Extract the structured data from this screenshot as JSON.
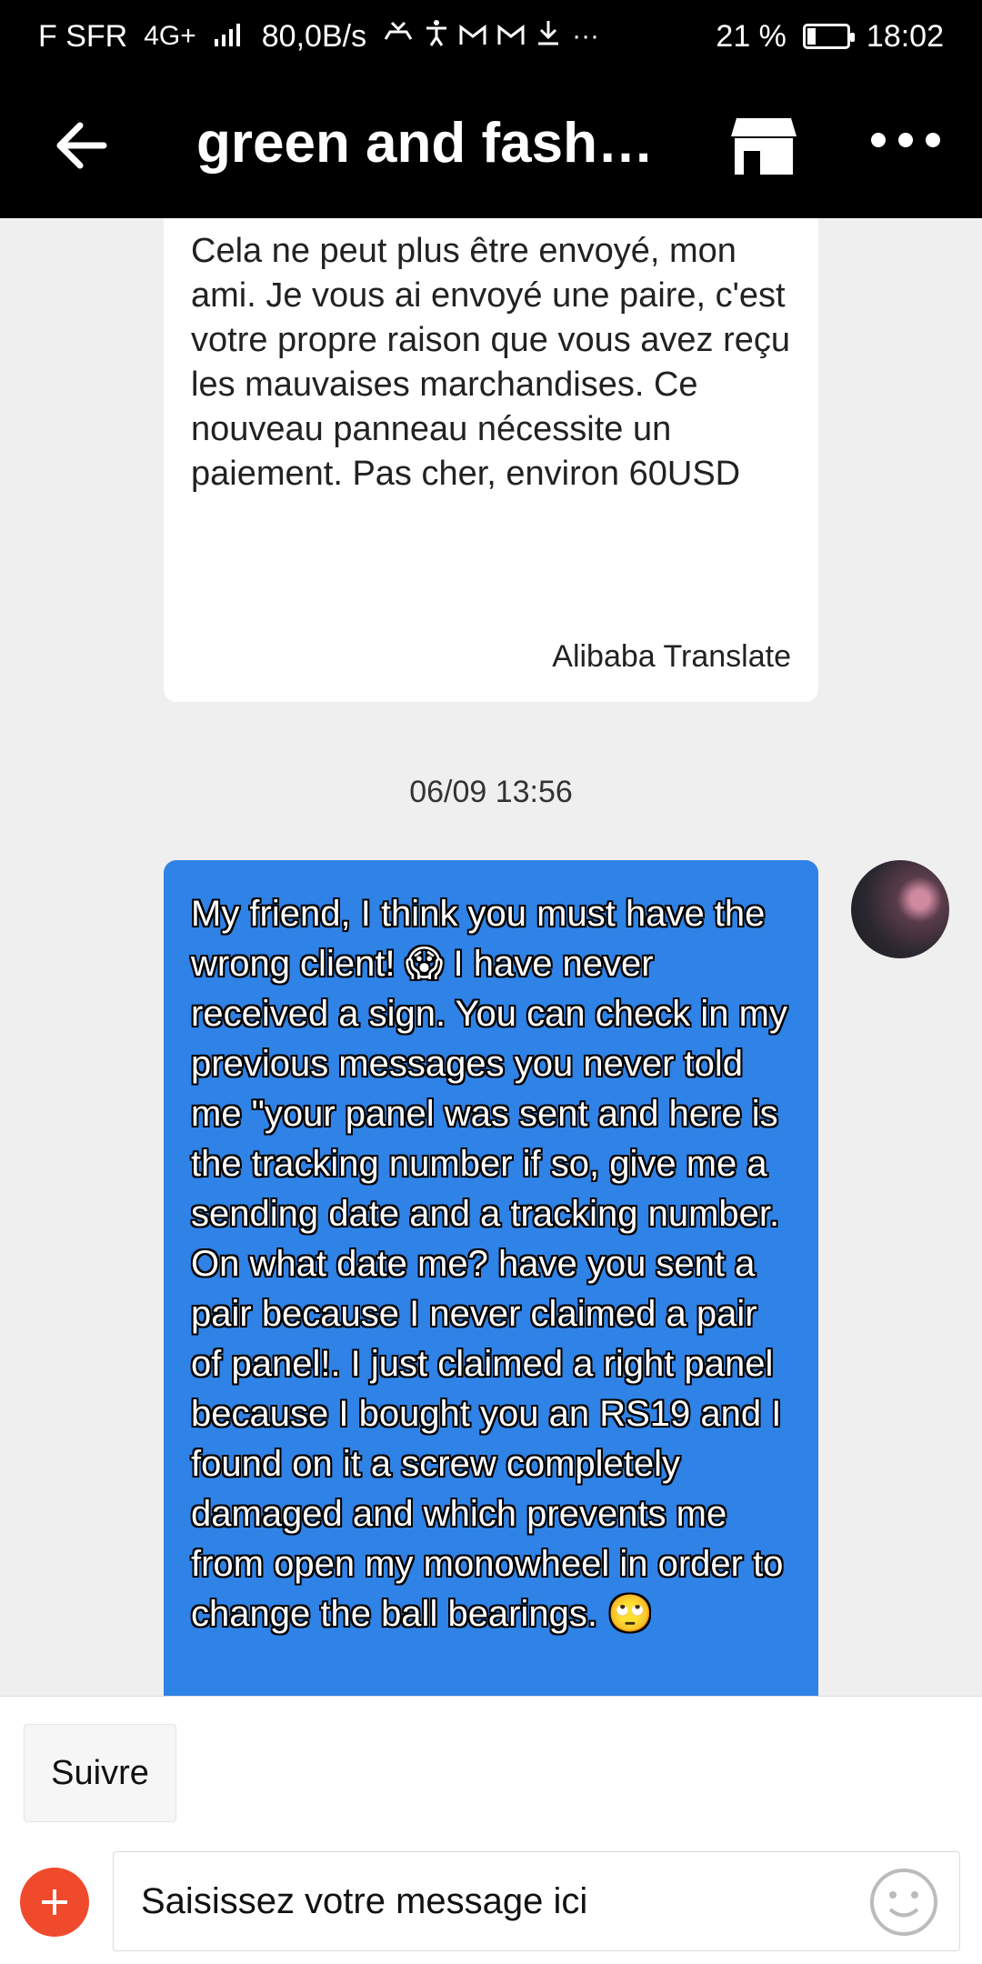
{
  "status_bar": {
    "carrier": "F SFR",
    "network_type": "4G+",
    "speed": "80,0B/s",
    "battery": "21 %",
    "time": "18:02",
    "icons": [
      "signal-icon",
      "missed-call-icon",
      "accessibility-icon",
      "gmail-icon",
      "gmail-icon",
      "download-icon",
      "more-notifications-icon",
      "battery-icon"
    ]
  },
  "header": {
    "title": "green and fashio…",
    "icons": [
      "back-arrow-icon",
      "store-icon",
      "more-icon"
    ]
  },
  "messages": {
    "incoming": {
      "text": "Cela ne peut plus être envoyé, mon ami. Je vous ai envoyé une paire, c'est votre propre raison que vous avez reçu les mauvaises marchandises. Ce nouveau panneau nécessite un paiement. Pas cher, environ 60USD",
      "translation_label": "Alibaba Translate"
    },
    "timestamp": "06/09 13:56",
    "outgoing": {
      "text": "My friend, I think you must have the wrong client!  😱 I have never received a sign.  You can check in my previous messages you never told me \"your panel was sent and here is the tracking number if so, give me a sending date and a tracking number. On what date me?  have you sent a pair because I never claimed a pair of panel!. I just claimed a right panel because I bought you an RS19 and I found on it a screw completely damaged and which prevents me from  open my monowheel in order to change the ball bearings. 🙄"
    }
  },
  "bottom_bar": {
    "follow_label": "Suivre",
    "input_placeholder": "Saisissez votre message ici",
    "icons": [
      "add-icon",
      "emoji-icon"
    ]
  },
  "colors": {
    "header_bg": "#000000",
    "chat_bg": "#efefef",
    "outgoing_bubble": "#2f82e6",
    "add_button": "#f04a2d"
  }
}
